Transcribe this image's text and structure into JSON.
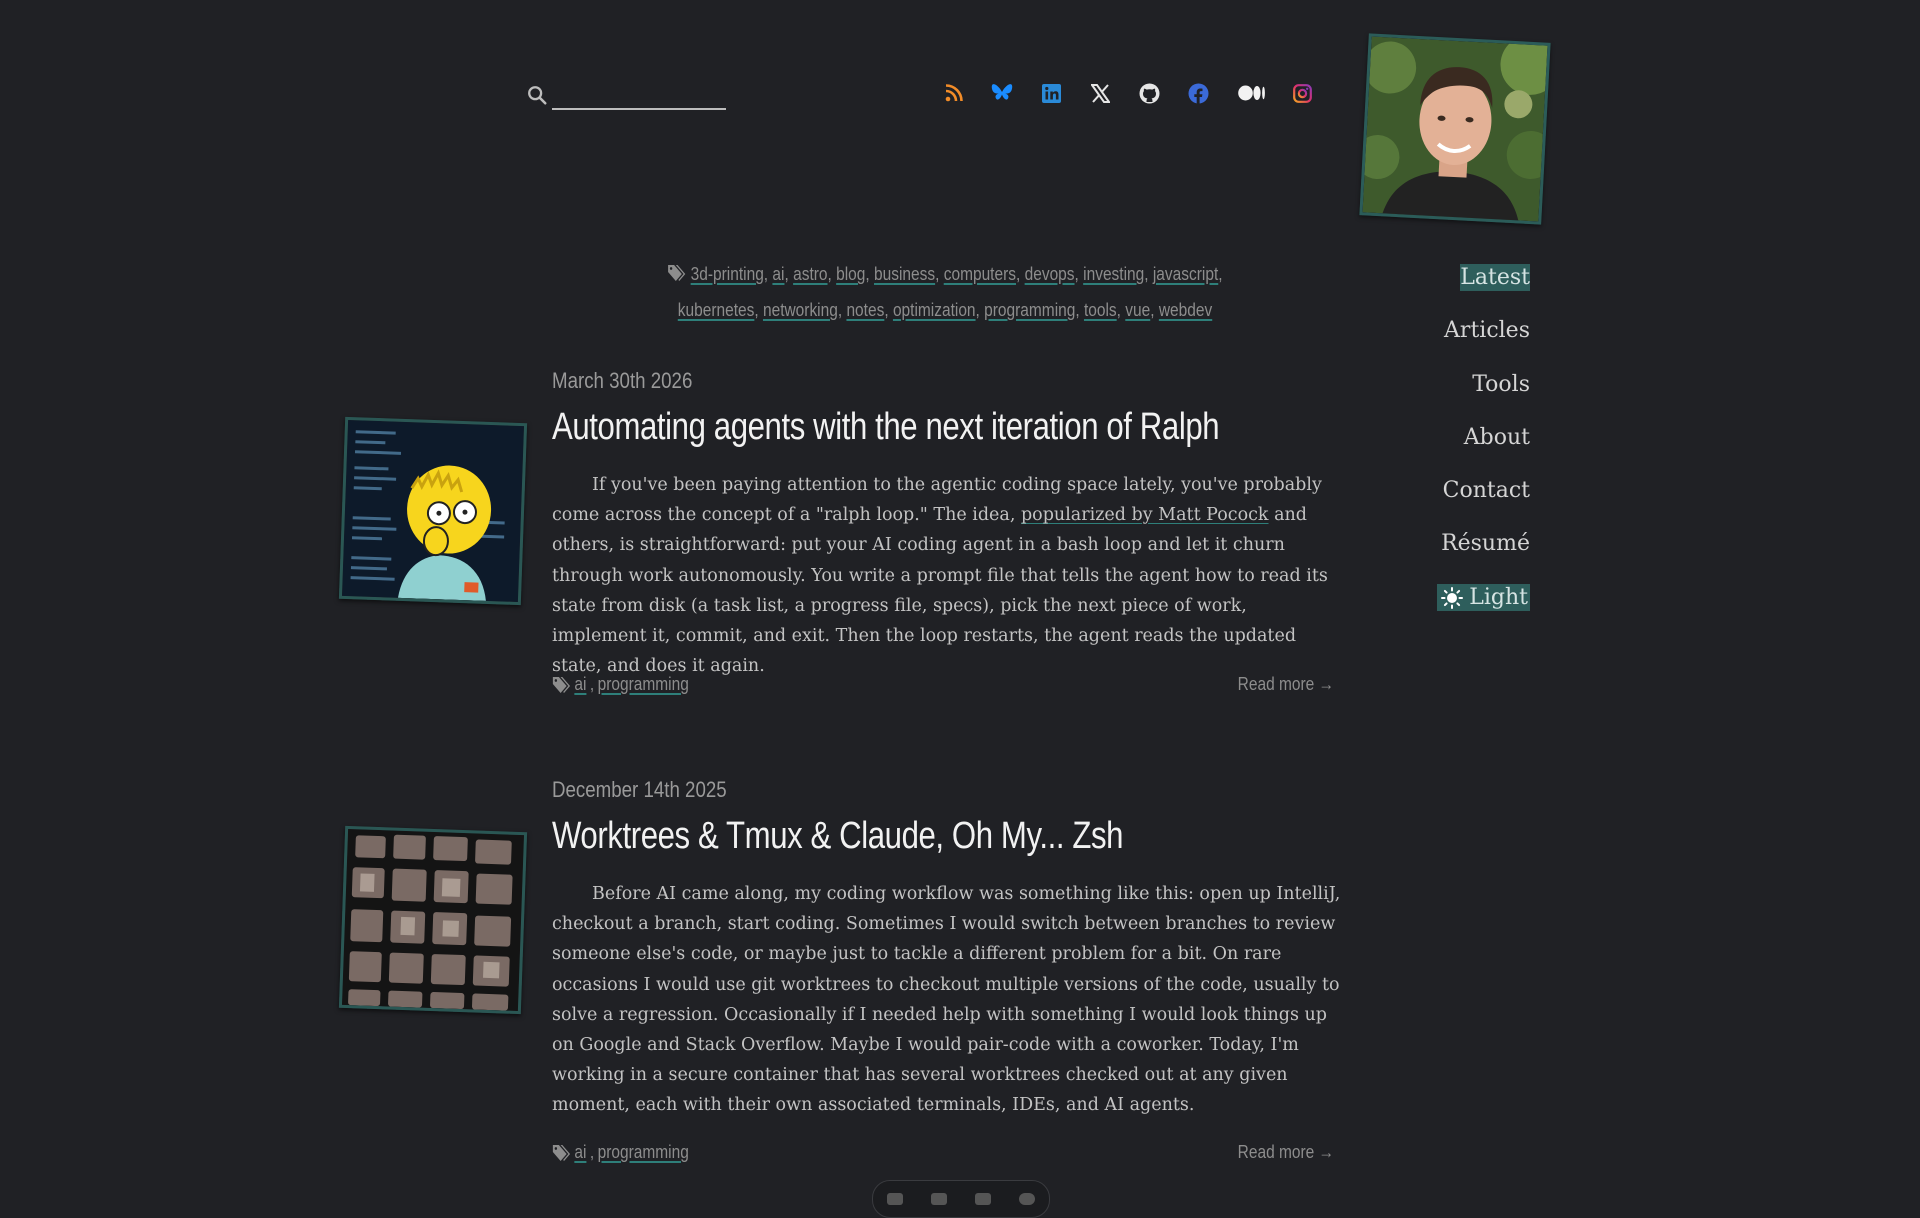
{
  "search": {
    "placeholder": "",
    "value": ""
  },
  "social": [
    {
      "name": "rss",
      "color": "#f28c28"
    },
    {
      "name": "bluesky",
      "color": "#1a8cff"
    },
    {
      "name": "linkedin",
      "color": "#2a8ad8"
    },
    {
      "name": "x",
      "color": "#e6e6e6"
    },
    {
      "name": "github",
      "color": "#e6e6e6"
    },
    {
      "name": "facebook",
      "color": "#3b6ad8"
    },
    {
      "name": "medium",
      "color": "#f2f2f2"
    },
    {
      "name": "instagram",
      "color": "#d6407a"
    }
  ],
  "nav": {
    "latest": "Latest",
    "articles": "Articles",
    "tools": "Tools",
    "about": "About",
    "contact": "Contact",
    "resume": "Résumé",
    "theme": "Light"
  },
  "tags": [
    "3d-printing",
    "ai",
    "astro",
    "blog",
    "business",
    "computers",
    "devops",
    "investing",
    "javascript",
    "kubernetes",
    "networking",
    "notes",
    "optimization",
    "programming",
    "tools",
    "vue",
    "webdev"
  ],
  "posts": [
    {
      "date": "March 30th 2026",
      "title": "Automating agents with the next iteration of Ralph",
      "excerpt_before": "If you've been paying attention to the agentic coding space lately, you've probably come across the concept of a \"ralph loop.\" The idea, ",
      "excerpt_link": "popularized by Matt Pocock",
      "excerpt_after": " and others, is straightforward: put your AI coding agent in a bash loop and let it churn through work autonomously. You write a prompt file that tells the agent how to read its state from disk (a task list, a progress file, specs), pick the next piece of work, implement it, commit, and exit. Then the loop restarts, the agent reads the updated state, and does it again.",
      "tags": [
        "ai",
        "programming"
      ],
      "read_more": "Read more →"
    },
    {
      "date": "December 14th 2025",
      "title": "Worktrees & Tmux & Claude, Oh My... Zsh",
      "excerpt": "Before AI came along, my coding workflow was something like this: open up IntelliJ, checkout a branch, start coding. Sometimes I would switch between branches to review someone else's code, or maybe just to tackle a different problem for a bit. On rare occasions I would use git worktrees to checkout multiple versions of the code, usually to solve a regression. Occasionally if I needed help with something I would look things up on Google and Stack Overflow. Maybe I would pair-code with a coworker. Today, I'm working in a secure container that has several worktrees checked out at any given moment, each with their own associated terminals, IDEs, and AI agents.",
      "tags": [
        "ai",
        "programming"
      ],
      "read_more": "Read more →"
    }
  ]
}
